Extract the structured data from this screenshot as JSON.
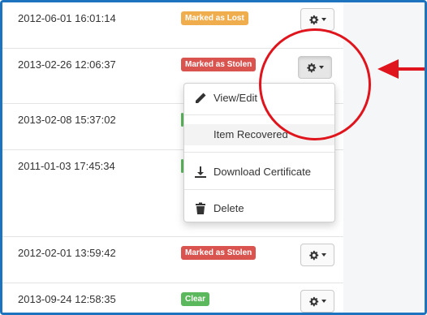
{
  "rows": [
    {
      "date": "2012-06-01 16:01:14",
      "status": "Marked as Lost",
      "status_color": "#f0ad4e"
    },
    {
      "date": "2013-02-26 12:06:37",
      "status": "Marked as Stolen",
      "status_color": "#d9534f"
    },
    {
      "date": "2013-02-08 15:37:02",
      "status": "",
      "status_color": "#5cb85c"
    },
    {
      "date": "2011-01-03 17:45:34",
      "status": "",
      "status_color": "#5cb85c"
    },
    {
      "date": "2012-02-01 13:59:42",
      "status": "Marked as Stolen",
      "status_color": "#d9534f"
    },
    {
      "date": "2013-09-24 12:58:35",
      "status": "Clear",
      "status_color": "#5cb85c"
    }
  ],
  "actions_menu": {
    "items": [
      {
        "label": "View/Edit",
        "icon": "pencil-icon"
      },
      {
        "label": "Item Recovered",
        "icon": ""
      },
      {
        "label": "Download Certificate",
        "icon": "download-icon"
      },
      {
        "label": "Delete",
        "icon": "trash-icon"
      }
    ],
    "highlighted_item": "Item Recovered"
  },
  "actions_button": {
    "icon": "gear-icon",
    "caret_icon": "caret-down-icon"
  },
  "annotation": {
    "color": "#e0141c",
    "shapes": [
      "circle",
      "arrow-left"
    ]
  }
}
